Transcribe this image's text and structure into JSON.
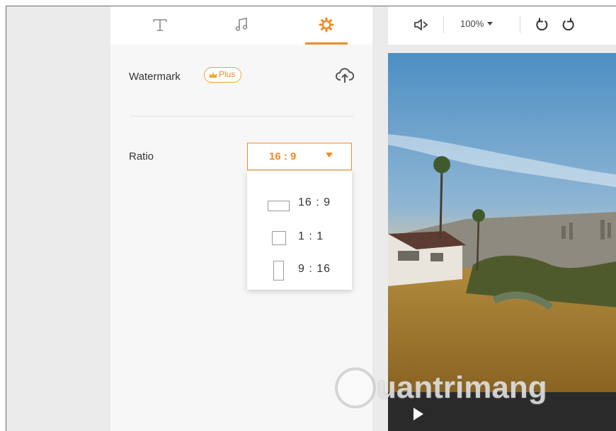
{
  "editor_tabs": [
    {
      "name": "Text",
      "icon": "text-icon"
    },
    {
      "name": "Audio",
      "icon": "music-note-icon"
    },
    {
      "name": "Settings",
      "icon": "gear-icon",
      "active": true
    }
  ],
  "settings": {
    "watermark_label": "Watermark",
    "plus_badge": "Plus",
    "upload_icon": "cloud-upload-icon",
    "ratio_label": "Ratio",
    "ratio_selected": "16 : 9",
    "ratio_options": [
      {
        "label": "16 : 9",
        "icon": "landscape-rect-icon"
      },
      {
        "label": "1 : 1",
        "icon": "square-rect-icon"
      },
      {
        "label": "9 : 16",
        "icon": "portrait-rect-icon"
      }
    ]
  },
  "preview_toolbar": {
    "volume_icon": "speaker-icon",
    "zoom": "100%",
    "undo_icon": "undo-icon",
    "redo_icon": "redo-icon"
  },
  "player": {
    "play_icon": "play-icon"
  },
  "watermark_text": "uantrimang",
  "colors": {
    "accent": "#f08a24",
    "panel_bg": "#f7f7f7",
    "player_bar": "#2a2a2a"
  }
}
